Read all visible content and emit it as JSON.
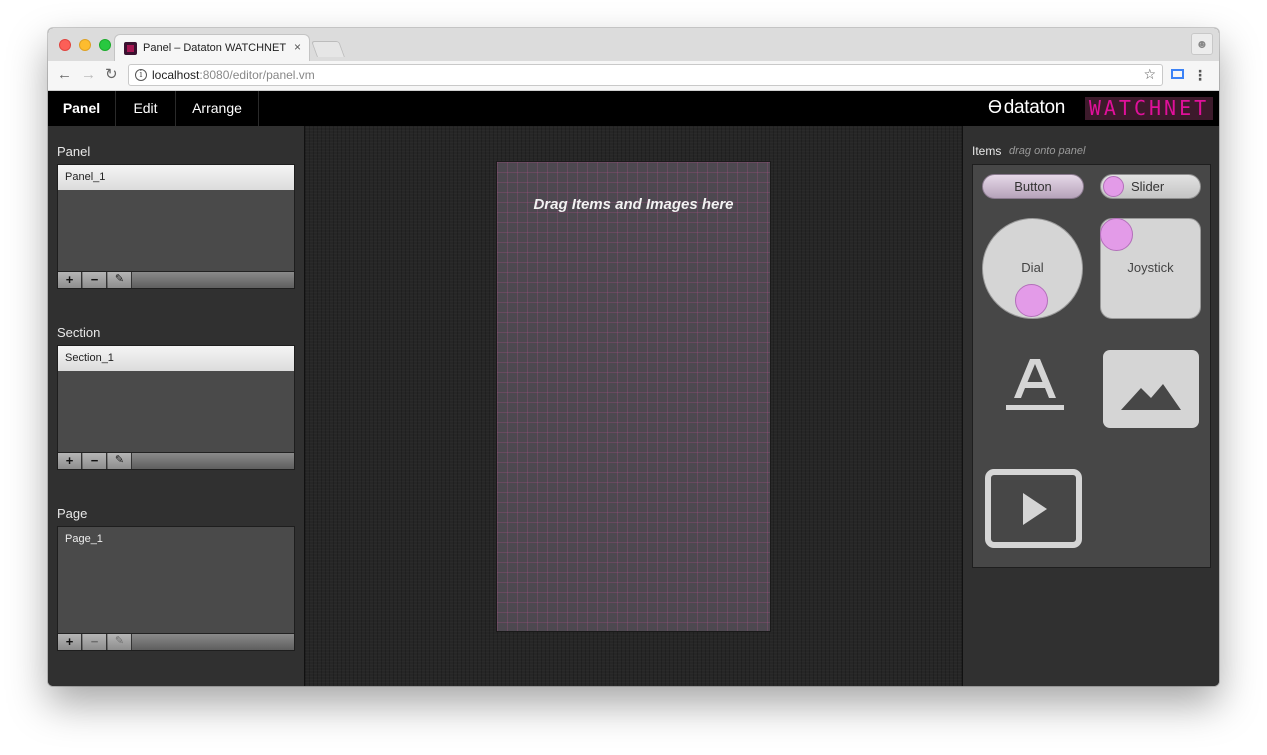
{
  "browser": {
    "tab_title": "Panel – Dataton WATCHNET",
    "tab_close": "×",
    "url_host": "localhost",
    "url_rest": ":8080/editor/panel.vm"
  },
  "menu": {
    "panel": "Panel",
    "edit": "Edit",
    "arrange": "Arrange"
  },
  "brand": {
    "dataton": "dataton",
    "watchnet": "WATCHNET",
    "accent_color": "#e0109a"
  },
  "sidebar": {
    "panel": {
      "title": "Panel",
      "items": [
        "Panel_1"
      ]
    },
    "section": {
      "title": "Section",
      "items": [
        "Section_1"
      ]
    },
    "page": {
      "title": "Page",
      "items": [
        "Page_1"
      ]
    },
    "tools": {
      "add": "+",
      "remove": "−",
      "edit": "✎"
    }
  },
  "canvas": {
    "hint": "Drag Items and Images here"
  },
  "items": {
    "title": "Items",
    "subtitle": "drag onto panel",
    "button": "Button",
    "slider": "Slider",
    "dial": "Dial",
    "joystick": "Joystick",
    "text_icon": "text-icon",
    "image_icon": "image-icon",
    "video_icon": "video-icon",
    "knob_color": "#e39be8"
  }
}
